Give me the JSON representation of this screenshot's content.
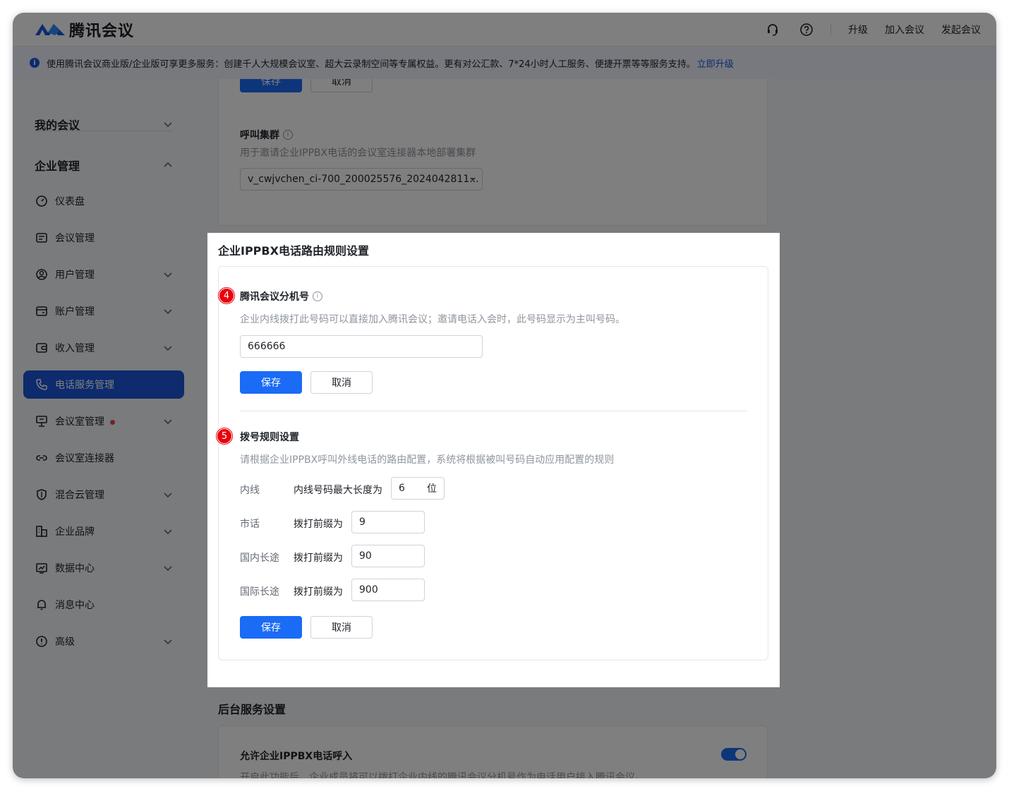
{
  "header": {
    "logo_text": "腾讯会议",
    "upgrade": "升级",
    "join_meeting": "加入会议",
    "start_meeting": "发起会议"
  },
  "banner": {
    "info_glyph": "i",
    "text": "使用腾讯会议商业版/企业版可享更多服务：创建千人大规模会议室、超大云录制空间等专属权益。更有对公汇款、7*24小时人工服务、便捷开票等等服务支持。",
    "upgrade_link": "立即升级"
  },
  "sidebar": {
    "my_meetings": "我的会议",
    "enterprise": "企业管理",
    "items": [
      {
        "label": "仪表盘",
        "icon": "dashboard-icon",
        "expandable": false
      },
      {
        "label": "会议管理",
        "icon": "meeting-list-icon",
        "expandable": false
      },
      {
        "label": "用户管理",
        "icon": "user-icon",
        "expandable": true
      },
      {
        "label": "账户管理",
        "icon": "account-icon",
        "expandable": true
      },
      {
        "label": "收入管理",
        "icon": "wallet-icon",
        "expandable": true
      },
      {
        "label": "电话服务管理",
        "icon": "phone-icon",
        "expandable": false,
        "active": true
      },
      {
        "label": "会议室管理",
        "icon": "room-icon",
        "expandable": true,
        "badge_dot": true
      },
      {
        "label": "会议室连接器",
        "icon": "link-icon",
        "expandable": false
      },
      {
        "label": "混合云管理",
        "icon": "cloud-icon",
        "expandable": true
      },
      {
        "label": "企业品牌",
        "icon": "brand-icon",
        "expandable": true
      },
      {
        "label": "数据中心",
        "icon": "data-icon",
        "expandable": true
      },
      {
        "label": "消息中心",
        "icon": "bell-icon",
        "expandable": false
      },
      {
        "label": "高级",
        "icon": "advanced-icon",
        "expandable": true
      }
    ]
  },
  "background": {
    "top_save": "保存",
    "top_cancel": "取消",
    "call_cluster_label": "呼叫集群",
    "call_cluster_info": "i",
    "call_cluster_desc": "用于邀请企业IPPBX电话的会议室连接器本地部署集群",
    "call_cluster_value": "v_cwjvchen_ci-700_200025576_2024042811...",
    "backend_title": "后台服务设置",
    "allow_inbound_label": "允许企业IPPBX电话呼入",
    "allow_inbound_desc": "开启此功能后，企业成员将可以拨打企业内线的腾讯会议分机号作为电话用户接入腾讯会议。"
  },
  "modal": {
    "title": "企业IPPBX电话路由规则设置",
    "step4": "4",
    "ext_label": "腾讯会议分机号",
    "ext_info": "i",
    "ext_desc": "企业内线拨打此号码可以直接加入腾讯会议；邀请电话入会时，此号码显示为主叫号码。",
    "ext_value": "666666",
    "save": "保存",
    "cancel": "取消",
    "step5": "5",
    "dial_label": "拨号规则设置",
    "dial_desc": "请根据企业IPPBX呼叫外线电话的路由配置，系统将根据被叫号码自动应用配置的规则",
    "rules": [
      {
        "type": "内线",
        "label": "内线号码最大长度为",
        "value": "6",
        "unit": "位"
      },
      {
        "type": "市话",
        "label": "拨打前缀为",
        "value": "9"
      },
      {
        "type": "国内长途",
        "label": "拨打前缀为",
        "value": "90"
      },
      {
        "type": "国际长途",
        "label": "拨打前缀为",
        "value": "900"
      }
    ],
    "save2": "保存",
    "cancel2": "取消"
  },
  "colors": {
    "accent": "#1a6bf5",
    "active_nav": "#1a56db",
    "step_badge": "#e8000b"
  }
}
